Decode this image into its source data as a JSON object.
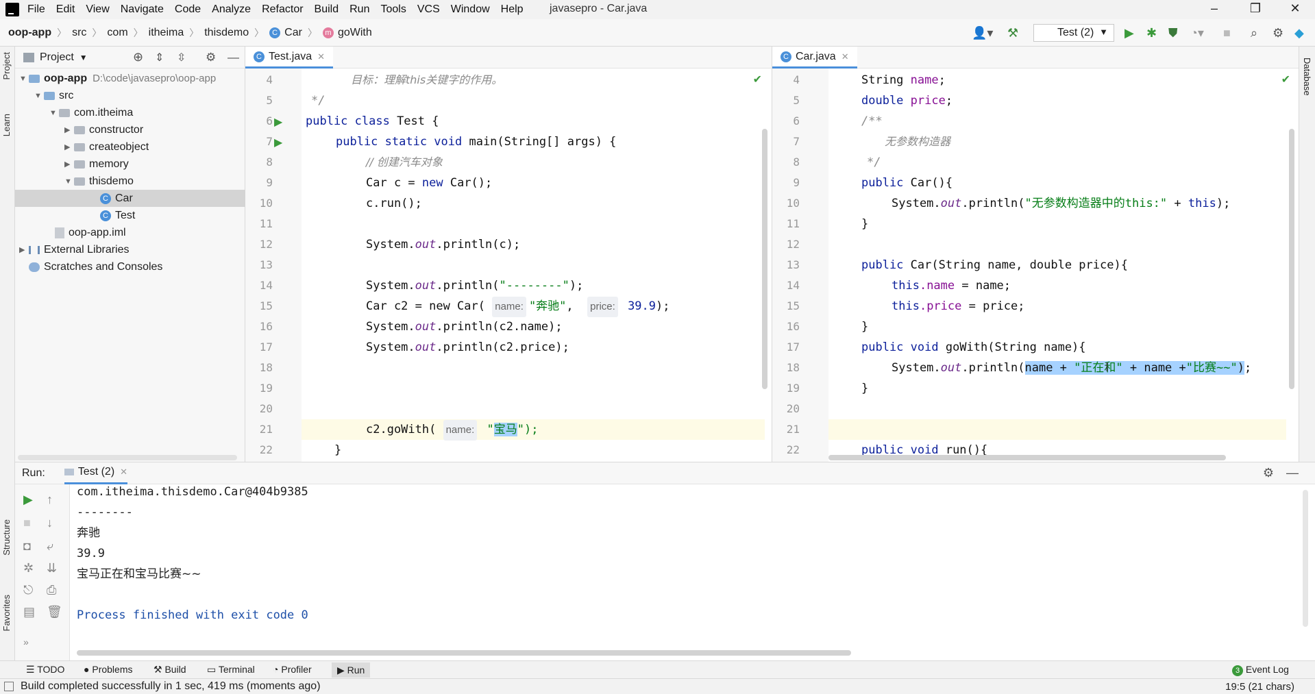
{
  "menubar": {
    "items": [
      "File",
      "Edit",
      "View",
      "Navigate",
      "Code",
      "Analyze",
      "Refactor",
      "Build",
      "Run",
      "Tools",
      "VCS",
      "Window",
      "Help"
    ],
    "title": "javasepro - Car.java"
  },
  "navbar": {
    "crumbs": [
      "oop-app",
      "src",
      "com",
      "itheima",
      "thisdemo",
      "Car",
      "goWith"
    ],
    "run_config": "Test (2)"
  },
  "left_strip": {
    "project": "Project",
    "learn": "Learn",
    "structure": "Structure",
    "favorites": "Favorites"
  },
  "right_strip": {
    "database": "Database"
  },
  "project": {
    "header": "Project",
    "root_name": "oop-app",
    "root_path": "D:\\code\\javasepro\\oop-app",
    "src": "src",
    "package": "com.itheima",
    "folders": [
      "constructor",
      "createobject",
      "memory",
      "thisdemo"
    ],
    "files": [
      "Car",
      "Test"
    ],
    "iml": "oop-app.iml",
    "external": "External Libraries",
    "scratches": "Scratches and Consoles"
  },
  "left_editor": {
    "tab": "Test.java",
    "line_numbers": [
      "4",
      "5",
      "6",
      "7",
      "8",
      "9",
      "10",
      "11",
      "12",
      "13",
      "14",
      "15",
      "16",
      "17",
      "18",
      "19",
      "20",
      "21",
      "22"
    ],
    "code": {
      "l4": "目标：理解this关键字的作用。",
      "l5": "*/",
      "l6_kw": "public class",
      "l6_rest": " Test {",
      "l7_kw": "public static void",
      "l7_rest": " main(String[] args) {",
      "l8": "// 创建汽车对象",
      "l9_a": "Car c = ",
      "l9_kw": "new",
      "l9_b": " Car();",
      "l10": "c.run();",
      "l12_a": "System.",
      "l12_it": "out",
      "l12_b": ".println(c);",
      "l14_a": "System.",
      "l14_it": "out",
      "l14_b": ".println(",
      "l14_str": "\"--------\"",
      "l14_c": ");",
      "l15_a": "Car c2 = new Car( ",
      "l15_hint1": "name:",
      "l15_str": "\"奔驰\"",
      "l15_sep": ",  ",
      "l15_hint2": "price:",
      "l15_num": " 39.9",
      "l15_c": ");",
      "l16_a": "System.",
      "l16_it": "out",
      "l16_b": ".println(c2.name);",
      "l17_a": "System.",
      "l17_it": "out",
      "l17_b": ".println(c2.price);",
      "l19_a": "c2.goWith( ",
      "l19_hint": "name:",
      "l19_q1": " \"",
      "l19_sel": "宝马",
      "l19_q2": "\");",
      "l21": "}",
      "l22": "}"
    }
  },
  "right_editor": {
    "tab": "Car.java",
    "line_numbers": [
      "4",
      "5",
      "6",
      "7",
      "8",
      "9",
      "10",
      "11",
      "12",
      "13",
      "14",
      "15",
      "16",
      "17",
      "18",
      "19",
      "20",
      "21",
      "22"
    ],
    "code": {
      "l4_a": "String ",
      "l4_f": "name",
      "l4_b": ";",
      "l5_a": "double ",
      "l5_f": "price",
      "l5_b": ";",
      "l6": "/**",
      "l7": "无参数构造器",
      "l8": "*/",
      "l9_kw": "public",
      "l9_rest": " Car(){",
      "l10_a": "System.",
      "l10_it": "out",
      "l10_b": ".println(",
      "l10_str": "\"无参数构造器中的this:\"",
      "l10_c": " + ",
      "l10_kw": "this",
      "l10_d": ");",
      "l11": "}",
      "l13_kw": "public",
      "l13_rest": " Car(String name, double price){",
      "l14_kw": "this",
      "l14_f": ".name",
      "l14_b": " = name;",
      "l15_kw": "this",
      "l15_f": ".price",
      "l15_b": " = price;",
      "l16": "}",
      "l18_kw": "public void",
      "l18_rest": " goWith(String name){",
      "l19_a": "System.",
      "l19_it": "out",
      "l19_b": ".println(",
      "l19_sel_a": "name + ",
      "l19_sel_s1": "\"正在和\"",
      "l19_sel_b": " + name +",
      "l19_sel_s2": "\"比赛~~\"",
      "l19_sel_c": ")",
      "l19_c": ";",
      "l20": "}",
      "l22_kw": "public void",
      "l22_rest": " run(){"
    }
  },
  "run_panel": {
    "label": "Run:",
    "tab": "Test (2)",
    "output": [
      "com.itheima.thisdemo.Car@404b9385",
      "--------",
      "奔驰",
      "39.9",
      "宝马正在和宝马比赛~~",
      "",
      "Process finished with exit code 0"
    ]
  },
  "bottom_tabs": [
    "TODO",
    "Problems",
    "Build",
    "Terminal",
    "Profiler",
    "Run"
  ],
  "event_log": "Event Log",
  "status": "Build completed successfully in 1 sec, 419 ms (moments ago)",
  "status_right": "19:5 (21 chars)"
}
